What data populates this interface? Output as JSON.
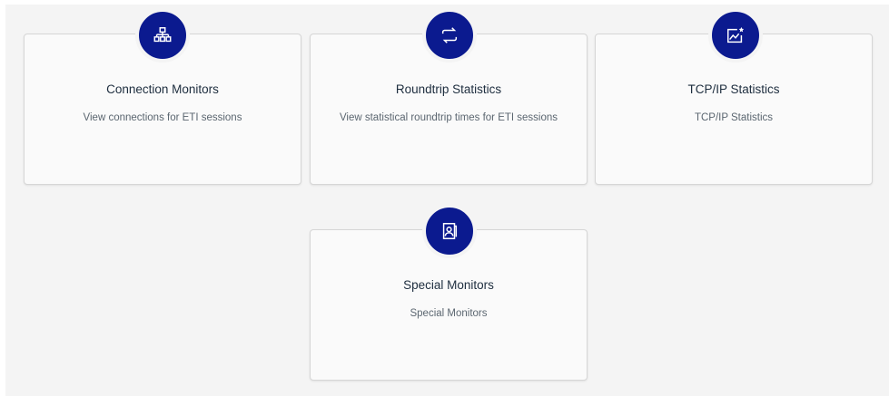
{
  "cards": [
    {
      "title": "Connection Monitors",
      "description": "View connections for ETI sessions",
      "icon": "network-hierarchy-icon"
    },
    {
      "title": "Roundtrip Statistics",
      "description": "View statistical roundtrip times for ETI sessions",
      "icon": "refresh-arrows-icon"
    },
    {
      "title": "TCP/IP Statistics",
      "description": "TCP/IP Statistics",
      "icon": "chart-star-icon"
    },
    {
      "title": "Special Monitors",
      "description": "Special Monitors",
      "icon": "person-card-icon"
    }
  ],
  "colors": {
    "badge": "#0b1a8f",
    "card_bg": "#fafafa",
    "page_bg": "#f4f4f4"
  }
}
